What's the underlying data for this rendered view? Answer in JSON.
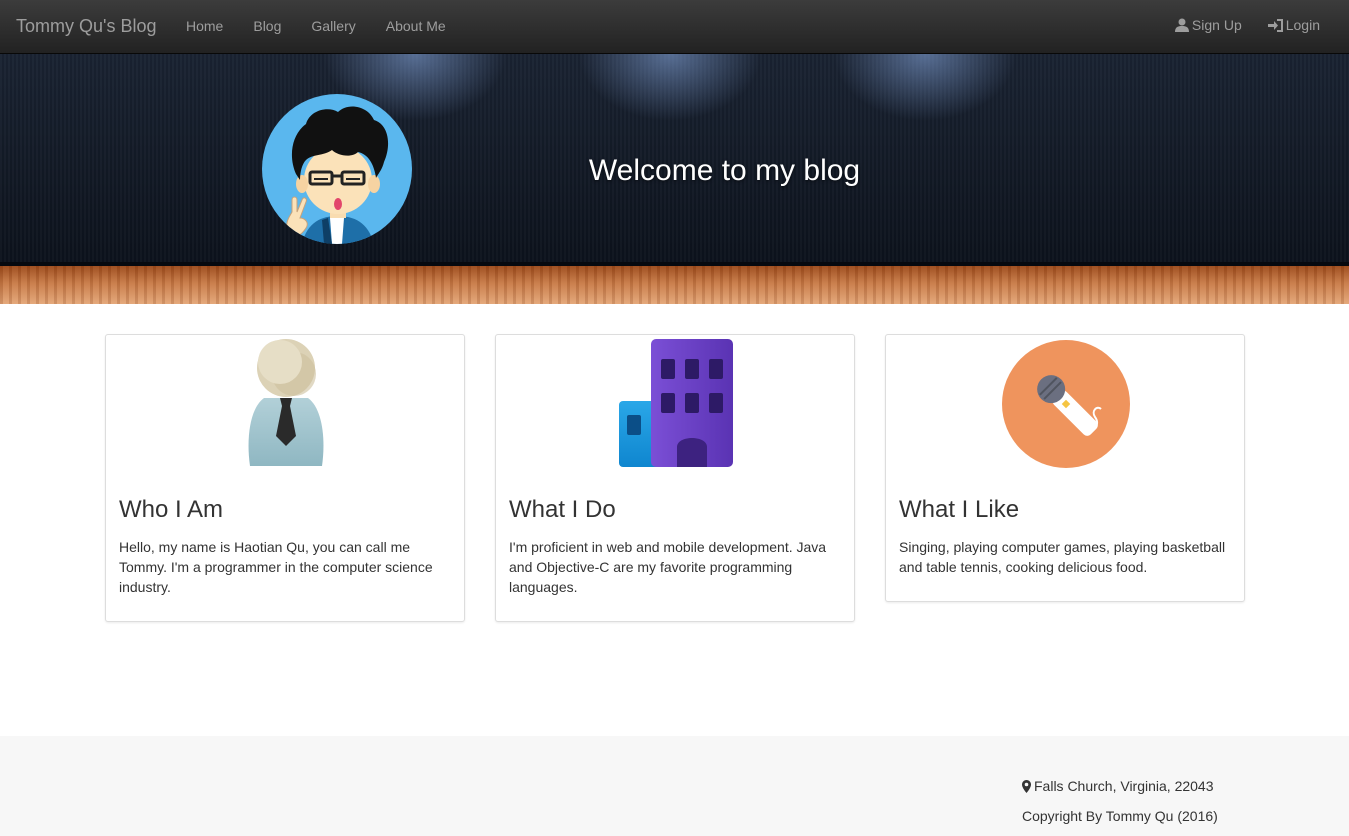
{
  "navbar": {
    "brand": "Tommy Qu's Blog",
    "links": [
      "Home",
      "Blog",
      "Gallery",
      "About Me"
    ],
    "signup": "Sign Up",
    "login": "Login"
  },
  "hero": {
    "title": "Welcome to my blog"
  },
  "cards": [
    {
      "title": "Who I Am",
      "text": "Hello, my name is Haotian Qu, you can call me Tommy. I'm a programmer in the computer science industry.",
      "icon": "person-icon"
    },
    {
      "title": "What I Do",
      "text": "I'm proficient in web and mobile development. Java and Objective-C are my favorite programming languages.",
      "icon": "building-icon"
    },
    {
      "title": "What I Like",
      "text": "Singing, playing computer games, playing basketball and table tennis, cooking delicious food.",
      "icon": "microphone-icon"
    }
  ],
  "footer": {
    "location": "Falls Church, Virginia, 22043",
    "copyright": "Copyright By Tommy Qu (2016)"
  },
  "colors": {
    "navbar": "#222222",
    "nav_text": "#9d9d9d",
    "avatar_bg": "#5ab7ee",
    "mic_bg": "#ef945d",
    "building": "#6a3fc4",
    "footer_bg": "#f7f7f7"
  }
}
